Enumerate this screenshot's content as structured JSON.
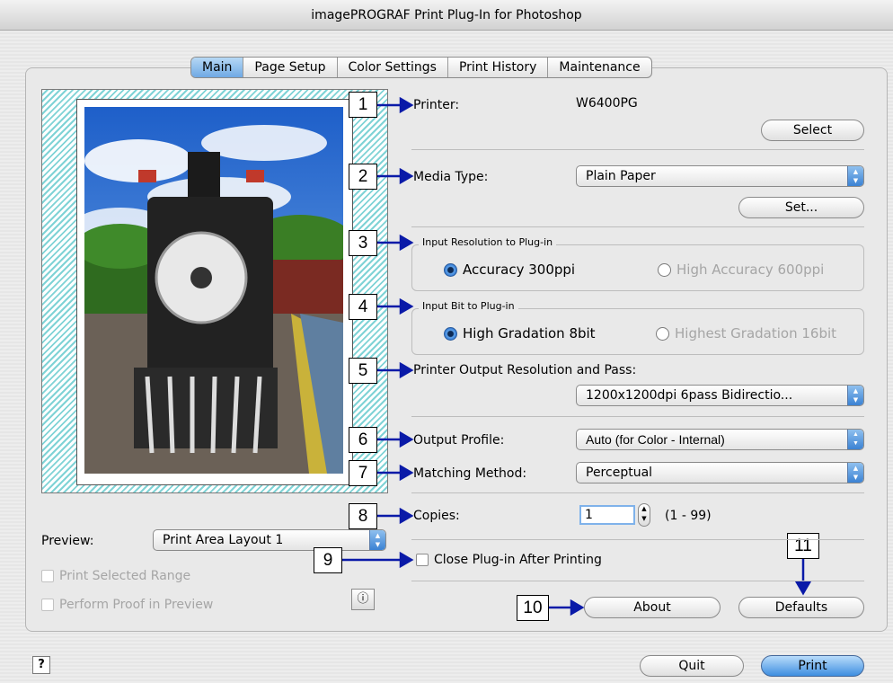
{
  "window": {
    "title": "imagePROGRAF Print Plug-In for Photoshop"
  },
  "tabs": [
    "Main",
    "Page Setup",
    "Color Settings",
    "Print History",
    "Maintenance"
  ],
  "active_tab": "Main",
  "left": {
    "preview_label": "Preview:",
    "preview_value": "Print Area Layout 1",
    "print_selected_range": "Print Selected Range",
    "perform_proof": "Perform Proof in Preview"
  },
  "printer": {
    "label": "Printer:",
    "value": "W6400PG",
    "select_button": "Select"
  },
  "media": {
    "label": "Media Type:",
    "value": "Plain Paper",
    "set_button": "Set..."
  },
  "input_resolution": {
    "legend": "Input Resolution to Plug-in",
    "option1": "Accuracy 300ppi",
    "option2": "High Accuracy 600ppi"
  },
  "input_bit": {
    "legend": "Input Bit to Plug-in",
    "option1": "High Gradation 8bit",
    "option2": "Highest Gradation 16bit"
  },
  "output_resolution": {
    "label": "Printer Output Resolution and Pass:",
    "value": "1200x1200dpi 6pass Bidirectio..."
  },
  "output_profile": {
    "label": "Output Profile:",
    "value": "Auto (for Color - Internal)"
  },
  "matching": {
    "label": "Matching Method:",
    "value": "Perceptual"
  },
  "copies": {
    "label": "Copies:",
    "value": "1",
    "range": "(1 - 99)"
  },
  "close_after": "Close Plug-in After Printing",
  "buttons": {
    "about": "About",
    "defaults": "Defaults",
    "quit": "Quit",
    "print": "Print"
  },
  "callouts": [
    "1",
    "2",
    "3",
    "4",
    "5",
    "6",
    "7",
    "8",
    "9",
    "10",
    "11"
  ],
  "help_glyph": "?",
  "colors": {
    "accent": "#3e8ee0",
    "callout_arrow": "#0a1aa8",
    "hatch": "#7fd3d6"
  }
}
